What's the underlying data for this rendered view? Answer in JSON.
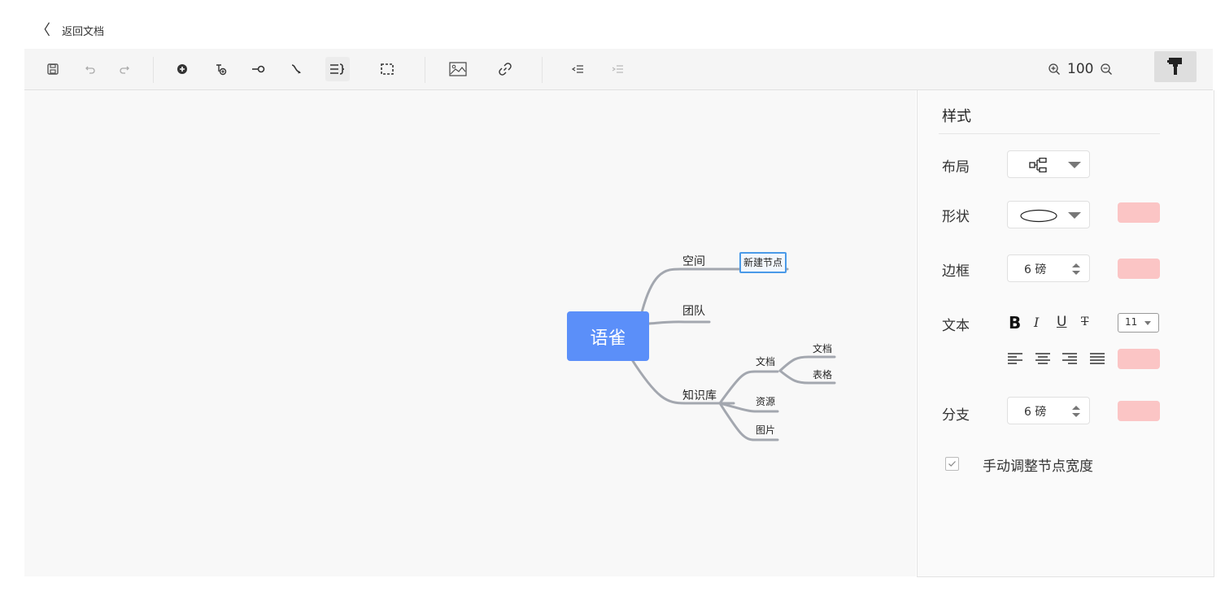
{
  "header": {
    "back_label": "返回文档"
  },
  "toolbar": {
    "zoom_value": "100",
    "icons": [
      "save-icon",
      "undo-icon",
      "redo-icon",
      "add-child-icon",
      "add-sibling-icon",
      "add-node-icon",
      "connector-icon",
      "summary-icon",
      "boundary-icon",
      "image-icon",
      "link-icon",
      "indent-left-icon",
      "indent-right-icon",
      "zoom-in-icon",
      "zoom-out-icon",
      "format-painter-icon"
    ]
  },
  "mindmap": {
    "root": "语雀",
    "branches": [
      {
        "label": "空间",
        "children": [
          {
            "label": "新建节点",
            "selected": true
          }
        ]
      },
      {
        "label": "团队",
        "children": []
      },
      {
        "label": "知识库",
        "children": [
          {
            "label": "文档",
            "children": [
              {
                "label": "文档"
              },
              {
                "label": "表格"
              }
            ]
          },
          {
            "label": "资源",
            "children": []
          },
          {
            "label": "图片",
            "children": []
          }
        ]
      }
    ],
    "colors": {
      "root": "#5b8ff9",
      "line": "#a3a7af",
      "selected_border": "#4a9ae8"
    }
  },
  "panel": {
    "title": "样式",
    "layout_label": "布局",
    "shape_label": "形状",
    "border_label": "边框",
    "border_value": "6 磅",
    "text_label": "文本",
    "text_bold": "B",
    "text_italic": "I",
    "text_underline": "U",
    "text_strike": "T",
    "font_size": "11",
    "branch_label": "分支",
    "branch_value": "6 磅",
    "manual_width_label": "手动调整节点宽度",
    "manual_width_checked": true,
    "swatch_color": "#fbc5c5"
  }
}
